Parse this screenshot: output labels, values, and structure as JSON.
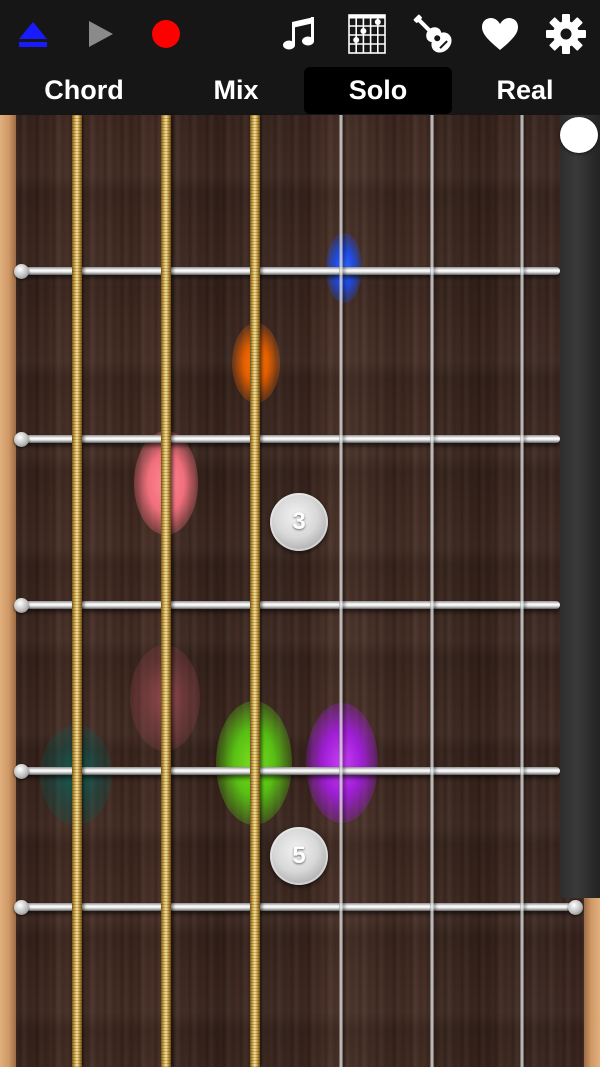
{
  "toolbar": {
    "icons": [
      "eject-icon",
      "play-icon",
      "record-icon",
      "music-note-icon",
      "chord-chart-icon",
      "guitar-icon",
      "heart-icon",
      "gear-icon"
    ],
    "colors": {
      "eject": "#1a1aff",
      "play": "#8a8a8a",
      "record": "#ff0000",
      "icon": "#ffffff"
    }
  },
  "tabs": [
    {
      "label": "Chord",
      "active": false
    },
    {
      "label": "Mix",
      "active": false
    },
    {
      "label": "Solo",
      "active": true
    },
    {
      "label": "Real",
      "active": false
    }
  ],
  "fretboard": {
    "markers": [
      {
        "label": "3"
      },
      {
        "label": "5"
      }
    ],
    "note_glow_colors": [
      "#1f5bff",
      "#ff6a00",
      "#ff6f7f",
      "#c35a6a",
      "#00766e",
      "#6bd51a",
      "#b12ee6"
    ]
  }
}
